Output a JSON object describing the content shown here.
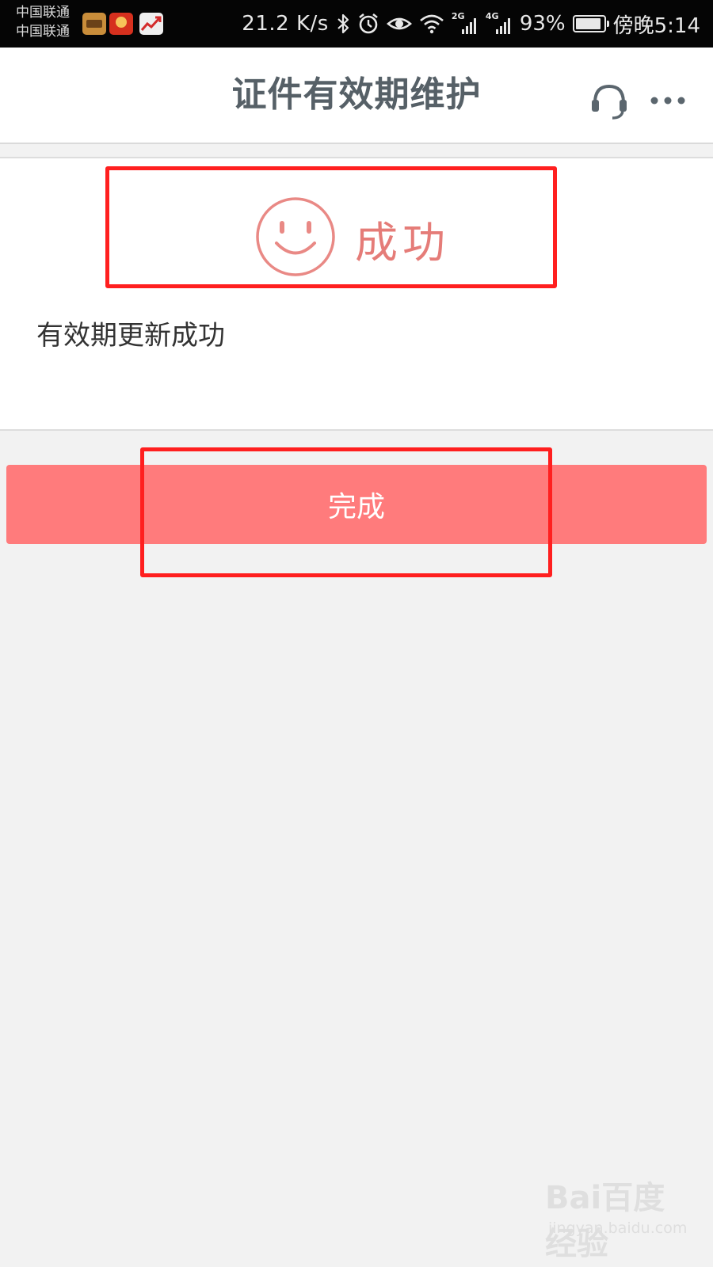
{
  "status_bar": {
    "carrier_1": "中国联通",
    "carrier_2": "中国联通",
    "net_speed": "21.2 K/s",
    "signal_1_gen": "2G",
    "signal_2_gen": "4G",
    "battery_percent": "93%",
    "battery_level": 0.93,
    "time": "傍晚5:14",
    "icons": [
      "wallet-app-icon",
      "chef-app-icon",
      "stock-app-icon",
      "bluetooth-icon",
      "alarm-icon",
      "eye-icon",
      "wifi-icon",
      "signal-icon",
      "battery-icon"
    ]
  },
  "header": {
    "title": "证件有效期维护",
    "icons": [
      "headset-icon",
      "more-icon"
    ]
  },
  "result": {
    "status_icon": "smiley-icon",
    "status_text": "成功",
    "message": "有效期更新成功"
  },
  "actions": {
    "done_label": "完成"
  },
  "watermark": {
    "brand": "Bai百度经验",
    "url": "jingyan.baidu.com"
  },
  "colors": {
    "accent": "#ff7b7c",
    "success_text": "#e57c78",
    "title_text": "#566067",
    "annotation_red": "#ff1f1f",
    "page_bg": "#f2f2f2"
  }
}
